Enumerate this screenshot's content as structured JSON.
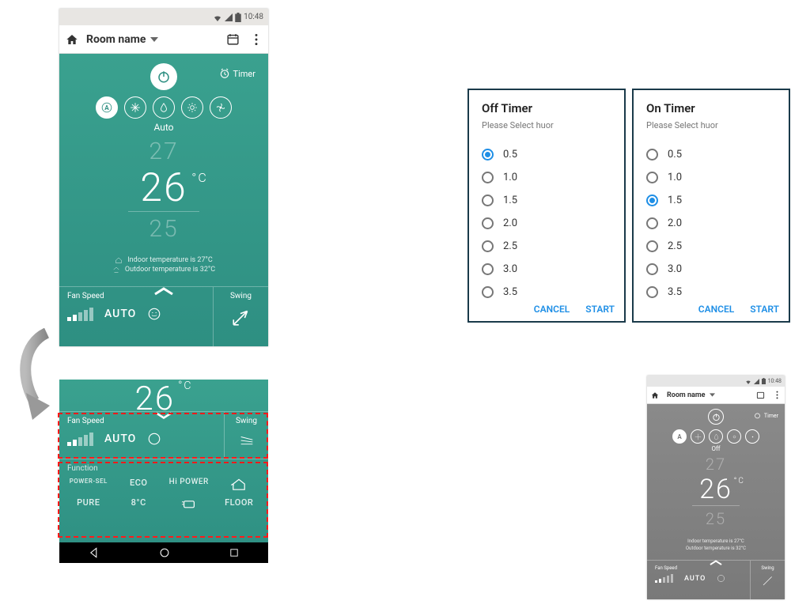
{
  "status": {
    "time": "10:48"
  },
  "appbar": {
    "title": "Room name"
  },
  "main": {
    "timer_label": "Timer",
    "mode_label_auto": "Auto",
    "mode_label_off": "Off",
    "temp_up": "27",
    "temp_main": "26",
    "temp_unit": "°C",
    "temp_down": "25",
    "indoor_line": "Indoor temperature is  27°C",
    "outdoor_line": "Outdoor temperature is  32°C"
  },
  "bottom": {
    "fanspeed_h": "Fan Speed",
    "auto": "AUTO",
    "swing_h": "Swing"
  },
  "functions": {
    "h": "Function",
    "items": [
      "POWER-SEL",
      "ECO",
      "Hi POWER",
      "",
      "PURE",
      "8°C",
      "",
      "FLOOR"
    ]
  },
  "dialog_off": {
    "title": "Off Timer",
    "subtitle": "Please Select huor",
    "options": [
      "0.5",
      "1.0",
      "1.5",
      "2.0",
      "2.5",
      "3.0",
      "3.5"
    ],
    "selected": "0.5",
    "cancel": "CANCEL",
    "start": "START"
  },
  "dialog_on": {
    "title": "On Timer",
    "subtitle": "Please Select huor",
    "options": [
      "0.5",
      "1.0",
      "1.5",
      "2.0",
      "2.5",
      "3.0",
      "3.5"
    ],
    "selected": "1.5",
    "cancel": "CANCEL",
    "start": "START"
  }
}
